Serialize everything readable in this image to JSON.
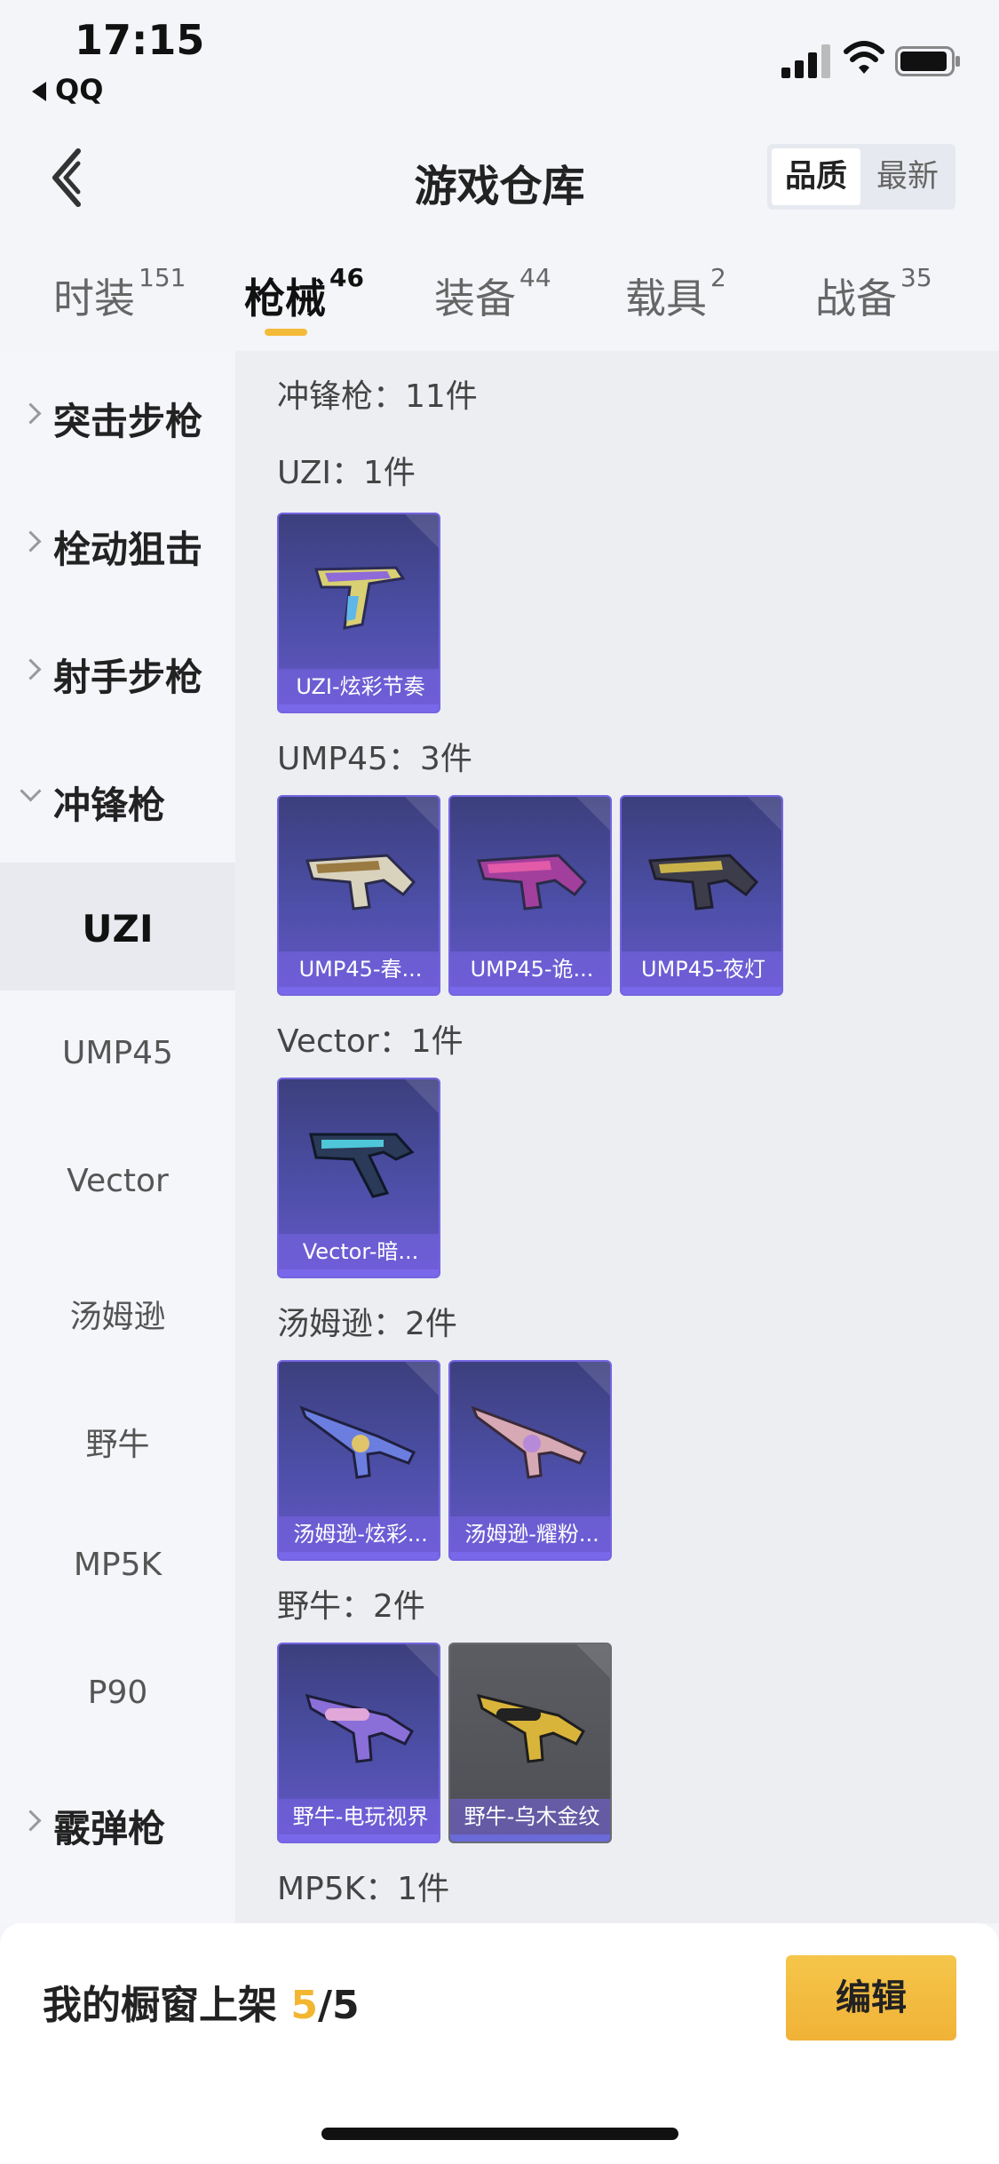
{
  "status_bar": {
    "time": "17:15",
    "back_app": "QQ"
  },
  "header": {
    "title": "游戏仓库",
    "sort_options": [
      "品质",
      "最新"
    ],
    "sort_active": "品质"
  },
  "tabs": [
    {
      "label": "时装",
      "count": "151"
    },
    {
      "label": "枪械",
      "count": "46"
    },
    {
      "label": "装备",
      "count": "44"
    },
    {
      "label": "载具",
      "count": "2"
    },
    {
      "label": "战备",
      "count": "35"
    }
  ],
  "active_tab": "枪械",
  "sidebar": {
    "groups": [
      "突击步枪",
      "栓动狙击",
      "射手步枪",
      "冲锋枪",
      "霰弹枪"
    ],
    "subitems": [
      "UZI",
      "UMP45",
      "Vector",
      "汤姆逊",
      "野牛",
      "MP5K",
      "P90"
    ],
    "active_subitem": "UZI"
  },
  "content": {
    "category_header": "冲锋枪：11件",
    "sections": [
      {
        "header": "UZI：1件",
        "items": [
          "UZI-炫彩节奏"
        ]
      },
      {
        "header": "UMP45：3件",
        "items": [
          "UMP45-春...",
          "UMP45-诡...",
          "UMP45-夜灯"
        ]
      },
      {
        "header": "Vector：1件",
        "items": [
          "Vector-暗..."
        ]
      },
      {
        "header": "汤姆逊：2件",
        "items": [
          "汤姆逊-炫彩...",
          "汤姆逊-耀粉..."
        ]
      },
      {
        "header": "野牛：2件",
        "items": [
          "野牛-电玩视界",
          "野牛-乌木金纹"
        ]
      },
      {
        "header": "MP5K：1件",
        "items": []
      }
    ]
  },
  "bottom_bar": {
    "showcase_label": "我的橱窗上架",
    "current": "5",
    "separator": "/",
    "max": "5",
    "edit_label": "编辑"
  },
  "colors": {
    "accent": "#f4bb3a",
    "card_purple": "#4d4fa8",
    "card_gray": "#55575d"
  },
  "icons": {
    "back": "chevron-left-icon",
    "signal": "cellular-signal-icon",
    "wifi": "wifi-icon",
    "battery": "battery-icon",
    "expand": "chevron-right-icon",
    "collapse": "chevron-down-icon"
  }
}
